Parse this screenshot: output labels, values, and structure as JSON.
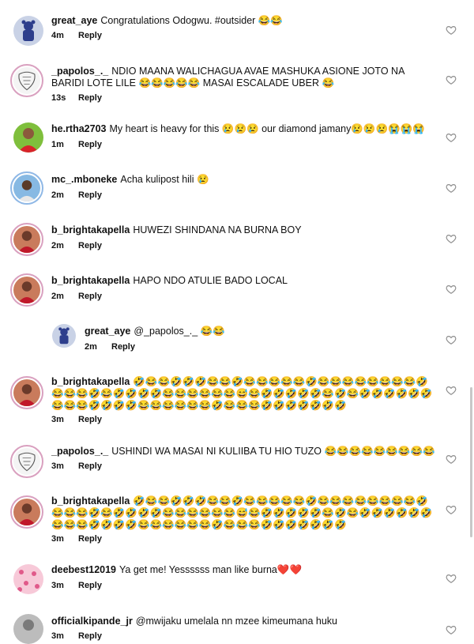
{
  "comments": [
    {
      "user": "great_aye",
      "text": "Congratulations Odogwu. #outsider 😂😂",
      "time": "4m",
      "reply": "Reply",
      "avatar": "bear-figure-avatar"
    },
    {
      "user": "_papolos_._",
      "text": "NDIO MAANA WALICHAGUA AVAE MASHUKA ASIONE JOTO NA BARIDI LOTE LILE 😂😂😂😂😂 MASAI ESCALADE UBER 😂",
      "time": "13s",
      "reply": "Reply",
      "avatar": "lion-sketch-avatar"
    },
    {
      "user": "he.rtha2703",
      "text": "My heart is heavy for this 😢😢😢 our diamond jamany😢😢😢😭😭😭",
      "time": "1m",
      "reply": "Reply",
      "avatar": "woman-red-outfit-avatar"
    },
    {
      "user": "mc_.mboneke",
      "text": "Acha kulipost hili 😢",
      "time": "2m",
      "reply": "Reply",
      "avatar": "man-portrait-avatar"
    },
    {
      "user": "b_brightakapella",
      "text": "HUWEZI SHINDANA NA BURNA BOY",
      "time": "2m",
      "reply": "Reply",
      "avatar": "person-red-avatar"
    },
    {
      "user": "b_brightakapella",
      "text": "HAPO NDO ATULIE BADO LOCAL",
      "time": "2m",
      "reply": "Reply",
      "avatar": "person-red-avatar"
    },
    {
      "user": "great_aye",
      "text": "@_papolos_._ 😂😂",
      "time": "2m",
      "reply": "Reply",
      "avatar": "bear-figure-avatar"
    },
    {
      "user": "b_brightakapella",
      "text": "🤣😂😂🤣🤣🤣😂😂🤣😂😂😂😂😂🤣😂😂😂😂😂😂😂😂🤣😂😂😂🤣😂🤣🤣🤣🤣😂😂😂😂😂😂😅😂🤣🤣🤣🤣🤣😂🤣😂🤣🤣🤣🤣🤣🤣😂😂😂🤣🤣🤣🤣😂😂😂😂😂😂🤣😂😂😂🤣🤣🤣🤣🤣🤣🤣",
      "time": "3m",
      "reply": "Reply",
      "avatar": "person-red-avatar"
    },
    {
      "user": "_papolos_._",
      "text": "USHINDI WA MASAI NI KULIIBA TU HIO TUZO 😂😂😂😂😂😂😂😂😂",
      "time": "3m",
      "reply": "Reply",
      "avatar": "lion-sketch-avatar"
    },
    {
      "user": "b_brightakapella",
      "text": "🤣😂😂🤣🤣🤣😂😂🤣😂😂😂😂😂🤣😂😂😂😂😂😂😂😂🤣😂😂😂🤣😂🤣🤣🤣🤣😂😂😂😂😂😂😅😂🤣🤣🤣🤣🤣😂🤣😂🤣🤣🤣🤣🤣🤣😂😂😂🤣🤣🤣🤣😂😂😂😂😂😂🤣😂😂😂🤣🤣🤣🤣🤣🤣🤣",
      "time": "3m",
      "reply": "Reply",
      "avatar": "person-red-avatar"
    },
    {
      "user": "deebest12019",
      "text": "Ya get me!  Yessssss man like burna❤️❤️",
      "time": "3m",
      "reply": "Reply",
      "avatar": "pink-pattern-avatar"
    },
    {
      "user": "officialkipande_jr",
      "text": "@mwijaku umelala nn mzee kimeumana huku",
      "time": "3m",
      "reply": "Reply",
      "avatar": "grey-avatar"
    }
  ],
  "colors": {
    "heart_outline": "#8e8e8e",
    "ring": "#d9a0bf"
  }
}
